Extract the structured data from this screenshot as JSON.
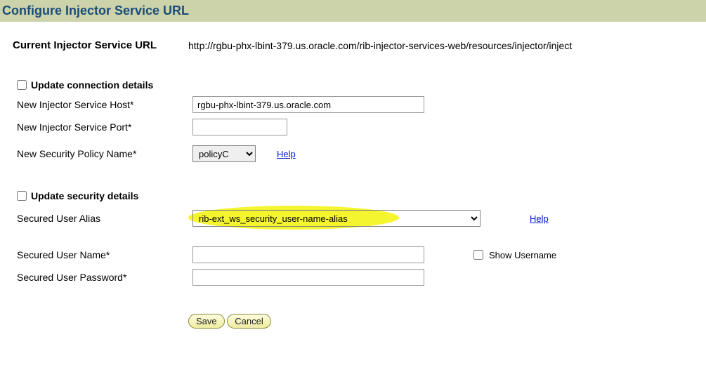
{
  "header": {
    "title": "Configure Injector Service URL"
  },
  "current": {
    "label": "Current Injector Service URL",
    "value": "http://rgbu-phx-lbint-379.us.oracle.com/rib-injector-services-web/resources/injector/inject"
  },
  "connection": {
    "checkbox_label": "Update connection details",
    "host_label": "New Injector Service Host*",
    "host_value": "rgbu-phx-lbint-379.us.oracle.com",
    "port_label": "New Injector Service Port*",
    "port_value": "",
    "policy_label": "New Security Policy Name*",
    "policy_value": "policyC",
    "help": "Help"
  },
  "security": {
    "checkbox_label": "Update security details",
    "alias_label": "Secured User Alias",
    "alias_value": "rib-ext_ws_security_user-name-alias",
    "alias_help": "Help",
    "username_label": "Secured User Name*",
    "username_value": "",
    "password_label": "Secured User Password*",
    "password_value": "",
    "show_username_label": "Show Username"
  },
  "buttons": {
    "save": "Save",
    "cancel": "Cancel"
  }
}
